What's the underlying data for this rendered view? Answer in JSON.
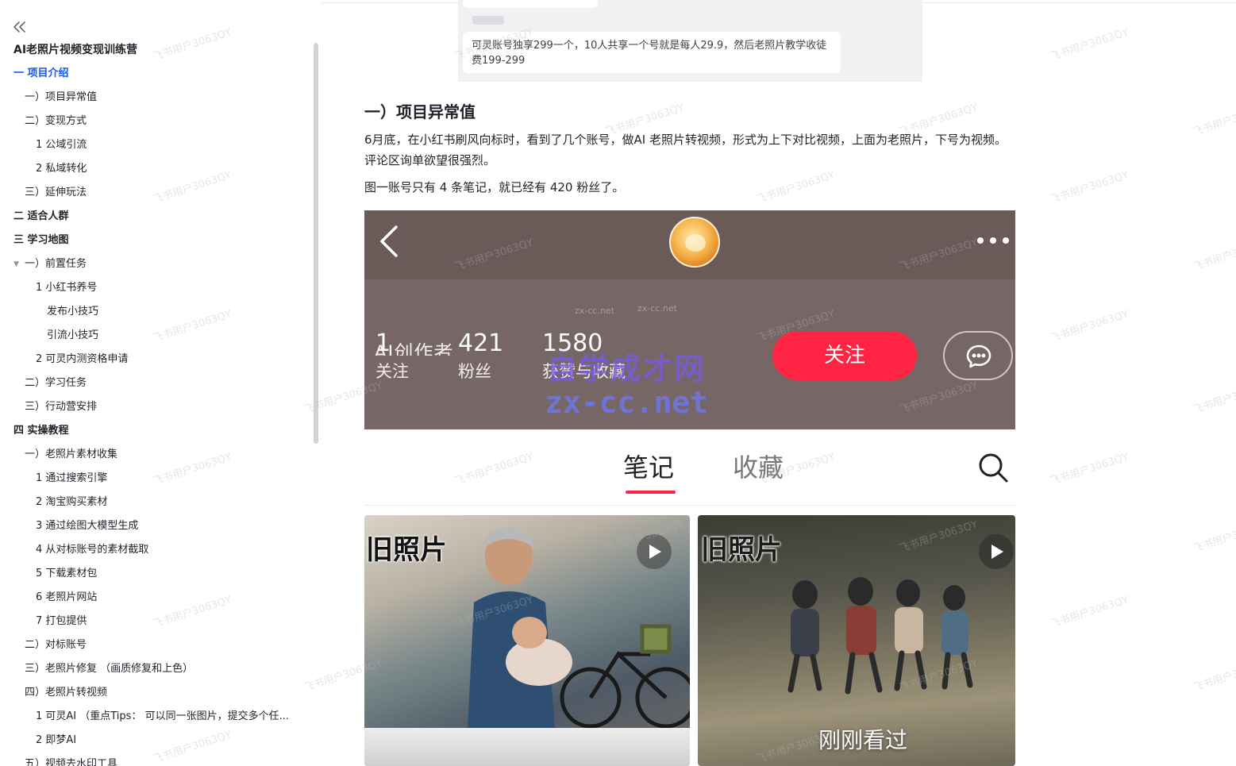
{
  "sidebar": {
    "collapse_icon": "chevrons-left-icon",
    "toc": [
      {
        "label": "AI老照片视频变现训练营",
        "level": 0,
        "kind": "title"
      },
      {
        "label": "一 项目介绍",
        "level": 0,
        "kind": "active"
      },
      {
        "label": "一）项目异常值",
        "level": 1
      },
      {
        "label": "二）变现方式",
        "level": 1
      },
      {
        "label": "1 公域引流",
        "level": 2
      },
      {
        "label": "2 私域转化",
        "level": 2
      },
      {
        "label": "三）延伸玩法",
        "level": 1
      },
      {
        "label": "二 适合人群",
        "level": 0
      },
      {
        "label": "三 学习地图",
        "level": 0
      },
      {
        "label": "一）前置任务",
        "level": 1,
        "expanded": true
      },
      {
        "label": "1 小红书养号",
        "level": 2
      },
      {
        "label": "发布小技巧",
        "level": 3
      },
      {
        "label": "引流小技巧",
        "level": 3
      },
      {
        "label": "2 可灵内测资格申请",
        "level": 2
      },
      {
        "label": "二）学习任务",
        "level": 1
      },
      {
        "label": "三）行动营安排",
        "level": 1
      },
      {
        "label": "四 实操教程",
        "level": 0
      },
      {
        "label": "一）老照片素材收集",
        "level": 1
      },
      {
        "label": "1 通过搜索引擎",
        "level": 2
      },
      {
        "label": "2 淘宝购买素材",
        "level": 2
      },
      {
        "label": "3 通过绘图大模型生成",
        "level": 2
      },
      {
        "label": "4 从对标账号的素材截取",
        "level": 2
      },
      {
        "label": "5 下载素材包",
        "level": 2
      },
      {
        "label": "6 老照片网站",
        "level": 2
      },
      {
        "label": "7 打包提供",
        "level": 2
      },
      {
        "label": "二）对标账号",
        "level": 1
      },
      {
        "label": "三）老照片修复 （画质修复和上色）",
        "level": 1
      },
      {
        "label": "四）老照片转视频",
        "level": 1
      },
      {
        "label": "1 可灵AI （重点Tips： 可以同一张图片，提交多个任...",
        "level": 2
      },
      {
        "label": "2 即梦AI",
        "level": 2
      },
      {
        "label": "五）视频去水印工具",
        "level": 1
      }
    ]
  },
  "chat_snippet": {
    "message": "可灵账号独享299一个，10人共享一个号就是每人29.9，然后老照片教学收徒费199-299"
  },
  "article": {
    "heading": "一）项目异常值",
    "para1": "6月底，在小红书刷风向标时，看到了几个账号，做AI 老照片转视频，形式为上下对比视频，上面为老照片，下号为视频。评论区询单欲望很强烈。",
    "para2": "图一账号只有 4 条笔记，就已经有 420 粉丝了。"
  },
  "phone_screenshot": {
    "creator_label": "AI创作者",
    "stats": [
      {
        "num": "1",
        "label": "关注"
      },
      {
        "num": "421",
        "label": "粉丝"
      },
      {
        "num": "1580",
        "label": "获赞与收藏"
      }
    ],
    "follow_label": "关注",
    "tabs": {
      "notes": "笔记",
      "favorites": "收藏"
    },
    "cards": [
      {
        "tag": "旧照片"
      },
      {
        "tag": "旧照片",
        "overlay": "刚刚看过"
      }
    ],
    "watermark_cn": "自学成才网",
    "watermark_en": "zx-cc.net",
    "mini_watermark": "zx-cc.net",
    "colors": {
      "accent": "#ff2442",
      "profile_bg": "#766766"
    }
  },
  "watermark_text": "飞书用户3063QY",
  "colors": {
    "link_active": "#1456f0"
  }
}
